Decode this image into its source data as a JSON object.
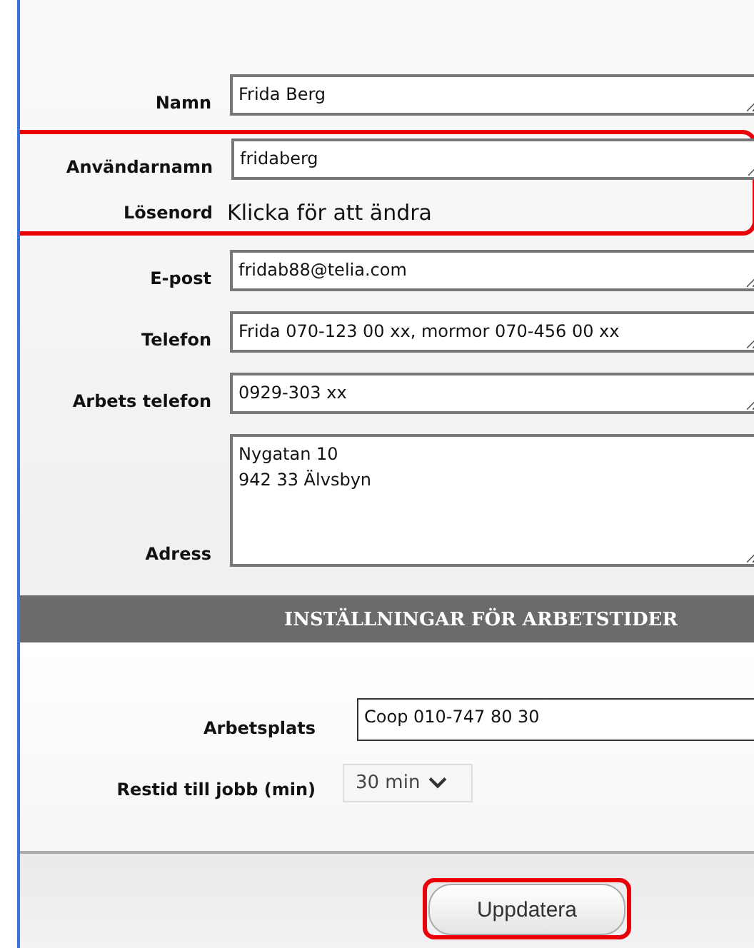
{
  "fields": [
    {
      "label": "Namn",
      "kind": "text",
      "value": "Frida Berg",
      "highlighted": false
    },
    {
      "label": "Användarnamn",
      "kind": "text",
      "value": "fridaberg",
      "highlighted": true
    },
    {
      "label": "Lösenord",
      "kind": "link",
      "value": "Klicka för att ändra",
      "highlighted": true
    },
    {
      "label": "E-post",
      "kind": "text",
      "value": "fridab88@telia.com",
      "highlighted": false
    },
    {
      "label": "Telefon",
      "kind": "text",
      "value": "Frida 070-123 00 xx, mormor 070-456 00 xx",
      "highlighted": false
    },
    {
      "label": "Arbets telefon",
      "kind": "text",
      "value": "0929-303 xx",
      "highlighted": false
    },
    {
      "label": "Adress",
      "kind": "area",
      "value": "Nygatan 10\n942 33 Älvsbyn",
      "highlighted": false
    }
  ],
  "section": {
    "title": "INSTÄLLNINGAR FÖR ARBETSTIDER",
    "fields": [
      {
        "label": "Arbetsplats",
        "kind": "text",
        "value": "Coop 010-747 80 30",
        "disabled": false
      },
      {
        "label": "Restid till jobb (min)",
        "kind": "select",
        "value": "30 min",
        "disabled": true
      }
    ]
  },
  "button": {
    "label": "Uppdatera",
    "highlighted": true
  }
}
